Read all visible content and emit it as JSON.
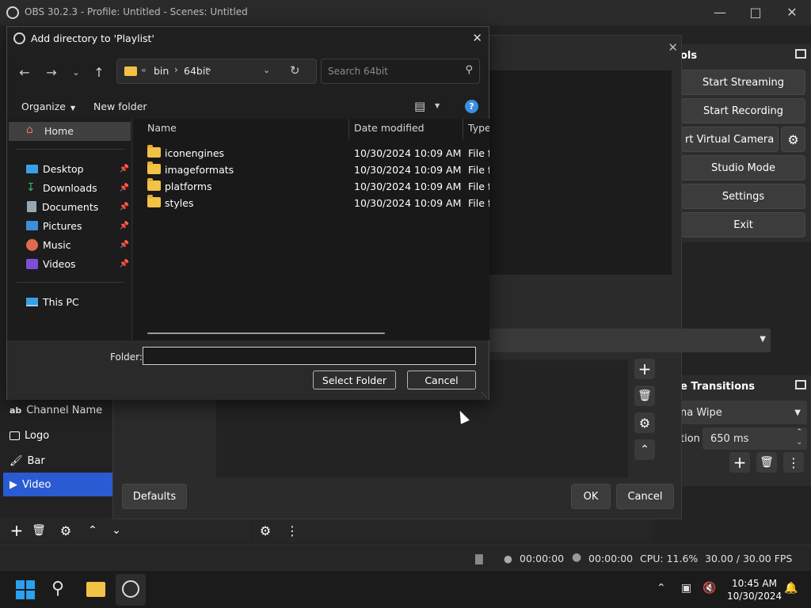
{
  "obs_window": {
    "title": "OBS 30.2.3 - Profile: Untitled - Scenes: Untitled"
  },
  "controls_dock": {
    "header": "ols",
    "start_streaming": "Start Streaming",
    "start_recording": "Start Recording",
    "virtual_camera": "rt Virtual Camera",
    "studio_mode": "Studio Mode",
    "settings": "Settings",
    "exit": "Exit"
  },
  "transitions_dock": {
    "header": "e Transitions",
    "transition": "na Wipe",
    "duration_label": "tion",
    "duration_value": "650 ms"
  },
  "sources": {
    "items": [
      {
        "label": "Channel Name",
        "icon": "text-icon",
        "prefix": "ab"
      },
      {
        "label": "Logo",
        "icon": "image-icon"
      },
      {
        "label": "Bar",
        "icon": "brush-icon"
      },
      {
        "label": "Video",
        "icon": "play-icon"
      }
    ],
    "selected_index": 3
  },
  "properties_dialog": {
    "defaults": "Defaults",
    "ok": "OK",
    "cancel": "Cancel"
  },
  "status_bar": {
    "stream_time": "00:00:00",
    "record_time": "00:00:00",
    "cpu": "CPU: 11.6%",
    "fps": "30.00 / 30.00 FPS"
  },
  "taskbar": {
    "time": "10:45 AM",
    "date": "10/30/2024"
  },
  "file_dialog": {
    "title": "Add directory to 'Playlist'",
    "breadcrumb": [
      "bin",
      "64bit"
    ],
    "search_placeholder": "Search 64bit",
    "organize": "Organize",
    "new_folder": "New folder",
    "nav_pane": {
      "home": "Home",
      "quick_access": [
        {
          "label": "Desktop",
          "icon": "desktop-icon",
          "color": "#3aa0e6"
        },
        {
          "label": "Downloads",
          "icon": "download-icon",
          "color": "#37b36a"
        },
        {
          "label": "Documents",
          "icon": "document-icon",
          "color": "#9aa6b2"
        },
        {
          "label": "Pictures",
          "icon": "pictures-icon",
          "color": "#3b8fd9"
        },
        {
          "label": "Music",
          "icon": "music-icon",
          "color": "#e06a4f"
        },
        {
          "label": "Videos",
          "icon": "video-icon",
          "color": "#7a4fd6"
        }
      ],
      "this_pc": "This PC"
    },
    "columns": [
      "Name",
      "Date modified",
      "Type"
    ],
    "files": [
      {
        "name": "iconengines",
        "modified": "10/30/2024 10:09 AM",
        "type": "File fo"
      },
      {
        "name": "imageformats",
        "modified": "10/30/2024 10:09 AM",
        "type": "File fo"
      },
      {
        "name": "platforms",
        "modified": "10/30/2024 10:09 AM",
        "type": "File fo"
      },
      {
        "name": "styles",
        "modified": "10/30/2024 10:09 AM",
        "type": "File fo"
      }
    ],
    "folder_label": "Folder:",
    "folder_value": "",
    "select_folder": "Select Folder",
    "cancel": "Cancel"
  }
}
